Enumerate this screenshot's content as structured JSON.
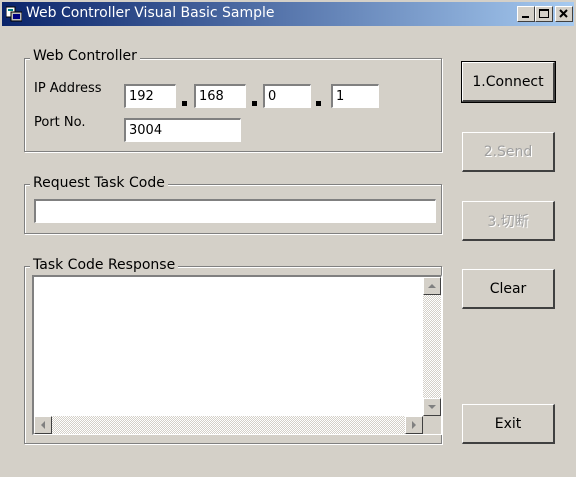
{
  "window": {
    "title": "Web Controller Visual Basic Sample"
  },
  "titlebar_buttons": {
    "minimize": "minimize-icon",
    "maximize": "maximize-icon",
    "close": "close-icon"
  },
  "web_controller": {
    "group_label": "Web Controller",
    "ip_label": "IP Address",
    "ip_octets": [
      "192",
      "168",
      "0",
      "1"
    ],
    "port_label": "Port No.",
    "port_value": "3004"
  },
  "request": {
    "group_label": "Request Task Code",
    "value": ""
  },
  "response": {
    "group_label": "Task Code Response",
    "value": ""
  },
  "buttons": {
    "connect": "1.Connect",
    "send": "2.Send",
    "disconnect": "3.切断",
    "clear": "Clear",
    "exit": "Exit"
  }
}
